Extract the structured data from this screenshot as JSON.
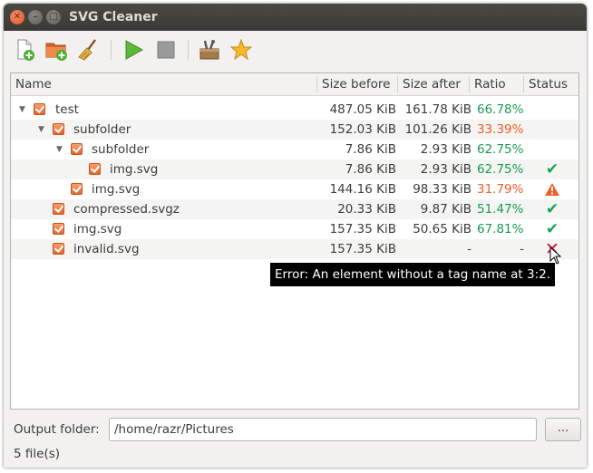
{
  "window": {
    "title": "SVG Cleaner"
  },
  "toolbar": {
    "icons": [
      "add-file-icon",
      "add-folder-icon",
      "clear-list-icon",
      "start-icon",
      "stop-icon",
      "preferences-icon",
      "about-icon"
    ]
  },
  "tree": {
    "columns": [
      "Name",
      "Size before",
      "Size after",
      "Ratio",
      "Status"
    ],
    "rows": [
      {
        "name": "test",
        "size_before": "487.05 KiB",
        "size_after": "161.78 KiB",
        "ratio": "66.78%",
        "status": ""
      },
      {
        "name": "subfolder",
        "size_before": "152.03 KiB",
        "size_after": "101.26 KiB",
        "ratio": "33.39%",
        "status": ""
      },
      {
        "name": "subfolder",
        "size_before": "7.86 KiB",
        "size_after": "2.93 KiB",
        "ratio": "62.75%",
        "status": ""
      },
      {
        "name": "img.svg",
        "size_before": "7.86 KiB",
        "size_after": "2.93 KiB",
        "ratio": "62.75%",
        "status": "ok"
      },
      {
        "name": "img.svg",
        "size_before": "144.16 KiB",
        "size_after": "98.33 KiB",
        "ratio": "31.79%",
        "status": "warning"
      },
      {
        "name": "compressed.svgz",
        "size_before": "20.33 KiB",
        "size_after": "9.87 KiB",
        "ratio": "51.47%",
        "status": "ok"
      },
      {
        "name": "img.svg",
        "size_before": "157.35 KiB",
        "size_after": "50.65 KiB",
        "ratio": "67.81%",
        "status": "ok"
      },
      {
        "name": "invalid.svg",
        "size_before": "157.35 KiB",
        "size_after": "-",
        "ratio": "-",
        "status": "error"
      }
    ]
  },
  "tooltip": {
    "text": "Error: An element without a tag name at 3:2."
  },
  "output": {
    "label": "Output folder:",
    "value": "/home/razr/Pictures",
    "browse_label": "..."
  },
  "statusbar": {
    "text": "5 file(s)"
  },
  "colors": {
    "ratio_good": "#199a55",
    "ratio_warn": "#f05d29",
    "status_ok": "#1aa05a",
    "status_error": "#d01030",
    "accent": "#e2672e"
  }
}
